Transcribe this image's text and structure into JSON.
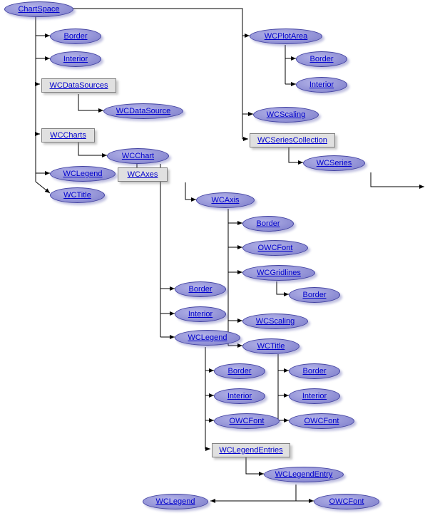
{
  "nodes": {
    "chartspace": "ChartSpace",
    "border1": "Border",
    "interior1": "Interior",
    "wcdatasources": "WCDataSources",
    "wcdatasource": "WCDataSource",
    "wccharts": "WCCharts",
    "wcchart": "WCChart",
    "wclegend1": "WCLegend",
    "wctitle1": "WCTitle",
    "wcaxes": "WCAxes",
    "wcaxis": "WCAxis",
    "border2": "Border",
    "owcfont1": "OWCFont",
    "wcgridlines": "WCGridlines",
    "border3": "Border",
    "wcscaling1": "WCScaling",
    "wctitle2": "WCTitle",
    "border4": "Border",
    "interior2": "Interior",
    "owcfont2": "OWCFont",
    "border5": "Border",
    "interior3": "Interior",
    "wclegend2": "WCLegend",
    "border6": "Border",
    "interior4": "Interior",
    "owcfont3": "OWCFont",
    "wclegendentries": "WCLegendEntries",
    "wclegendentry": "WCLegendEntry",
    "wclegend3": "WCLegend",
    "owcfont4": "OWCFont",
    "wcplotarea": "WCPlotArea",
    "border7": "Border",
    "interior5": "Interior",
    "wcscaling2": "WCScaling",
    "wcseriescollection": "WCSeriesCollection",
    "wcseries": "WCSeries"
  }
}
